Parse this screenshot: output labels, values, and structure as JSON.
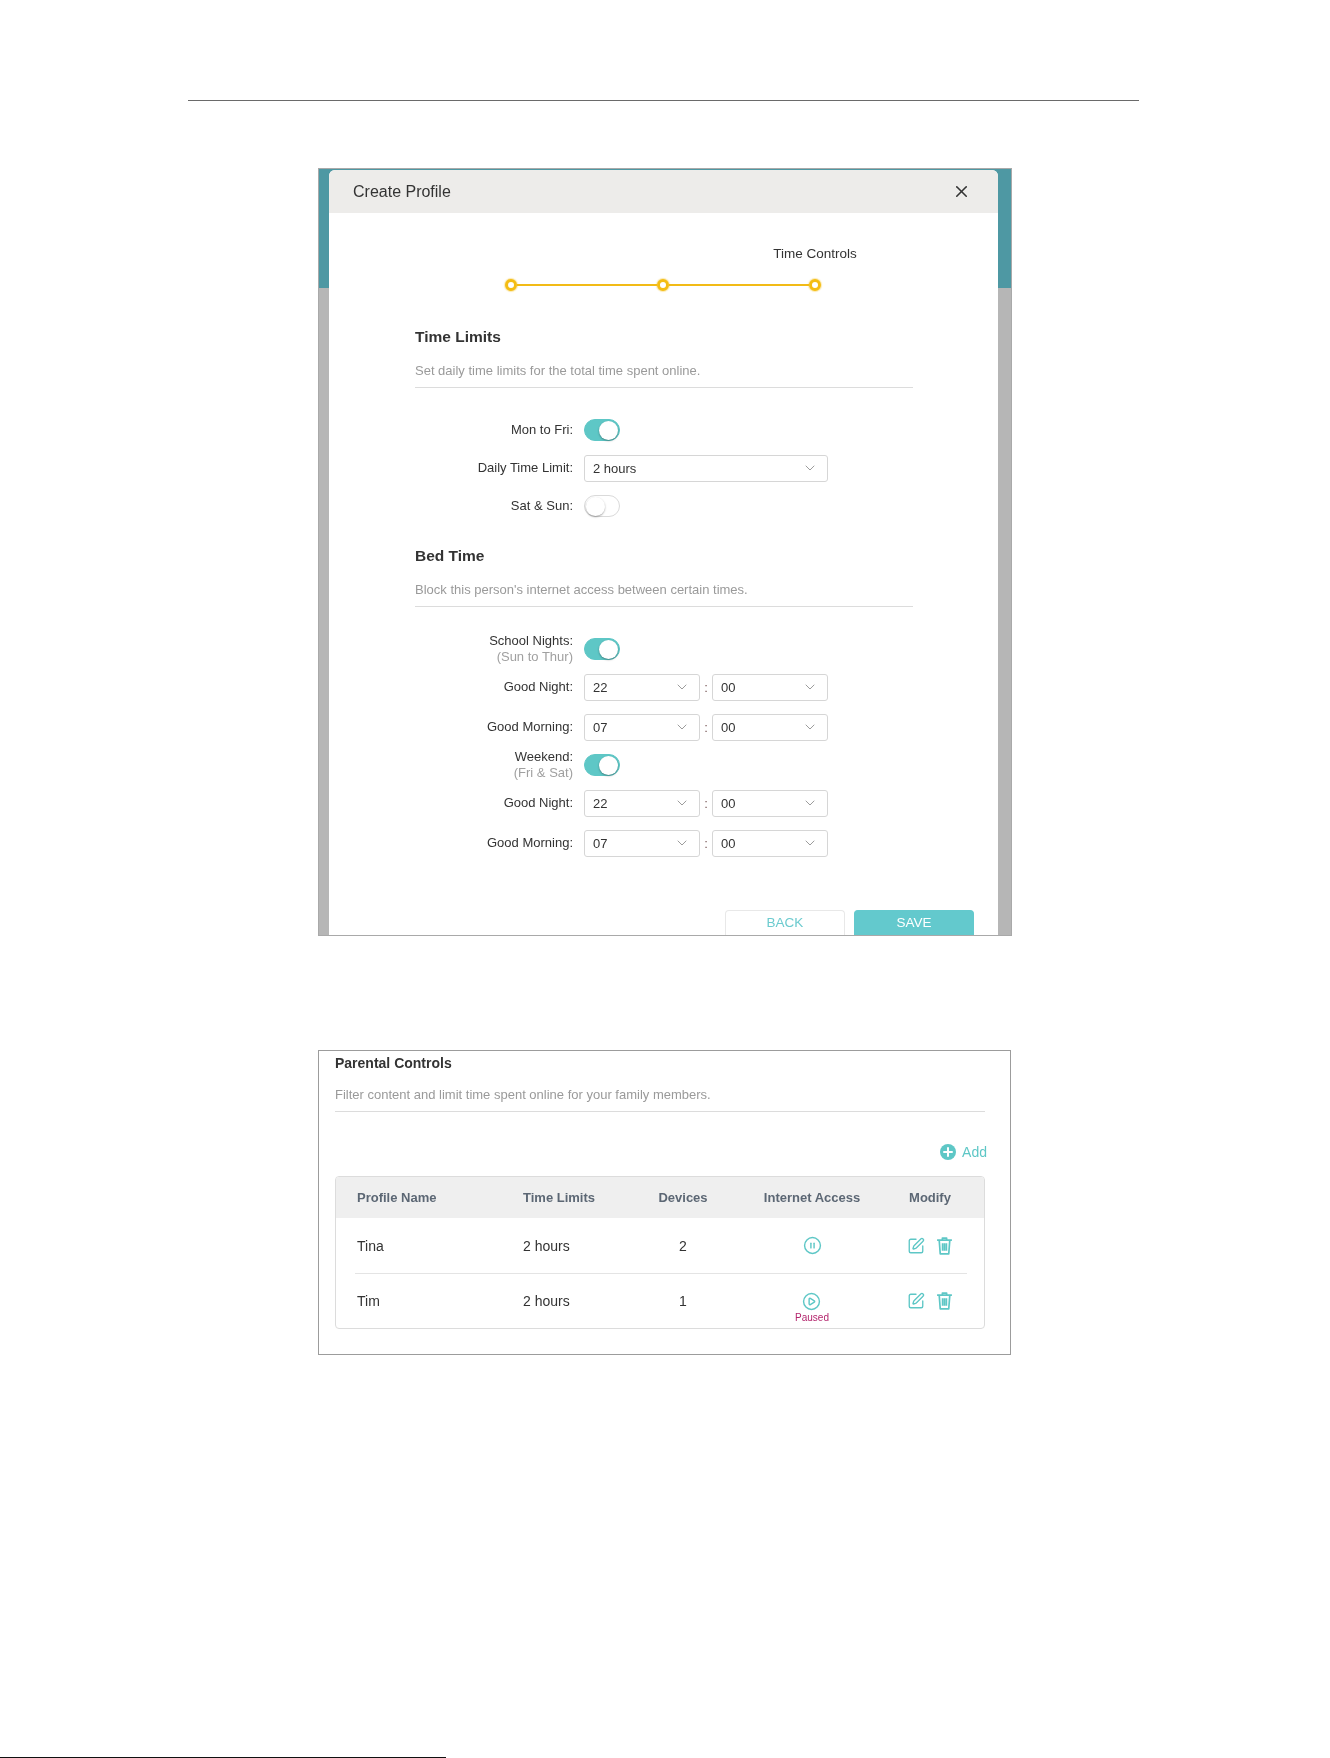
{
  "dialog": {
    "title": "Create Profile",
    "stepper": {
      "steps": [
        {
          "active": true
        },
        {
          "active": true
        },
        {
          "active": true,
          "label": "Time Controls"
        }
      ]
    },
    "sections": [
      {
        "heading": "Time Limits",
        "description": "Set daily time limits for the total time spent online.",
        "rows": [
          {
            "kind": "toggle",
            "label": "Mon to Fri:",
            "on": true
          },
          {
            "kind": "select",
            "label": "Daily Time Limit:",
            "value": "2 hours"
          },
          {
            "kind": "toggle",
            "label": "Sat & Sun:",
            "on": false
          }
        ]
      },
      {
        "heading": "Bed Time",
        "description": "Block this person's internet access between certain times.",
        "rows": [
          {
            "kind": "toggle",
            "label": "School Nights:",
            "note": "(Sun to Thur)",
            "on": true
          },
          {
            "kind": "time",
            "label": "Good Night:",
            "hour": "22",
            "separator": ":",
            "minute": "00"
          },
          {
            "kind": "time",
            "label": "Good Morning:",
            "hour": "07",
            "separator": ":",
            "minute": "00"
          },
          {
            "kind": "toggle",
            "label": "Weekend:",
            "note": "(Fri & Sat)",
            "on": true
          },
          {
            "kind": "time",
            "label": "Good Night:",
            "hour": "22",
            "separator": ":",
            "minute": "00"
          },
          {
            "kind": "time",
            "label": "Good Morning:",
            "hour": "07",
            "separator": ":",
            "minute": "00"
          }
        ]
      }
    ],
    "buttons": [
      {
        "kind": "secondary",
        "label": "BACK"
      },
      {
        "kind": "primary",
        "label": "SAVE"
      }
    ]
  },
  "parental_controls": {
    "title": "Parental Controls",
    "description": "Filter content and limit time spent online for your family members.",
    "add_label": "Add",
    "columns": [
      "Profile Name",
      "Time Limits",
      "Devices",
      "Internet Access",
      "Modify"
    ],
    "rows": [
      {
        "profile_name": "Tina",
        "time_limits": "2 hours",
        "devices": "2",
        "paused": false
      },
      {
        "profile_name": "Tim",
        "time_limits": "2 hours",
        "devices": "1",
        "paused": true,
        "status": "Paused"
      }
    ]
  }
}
